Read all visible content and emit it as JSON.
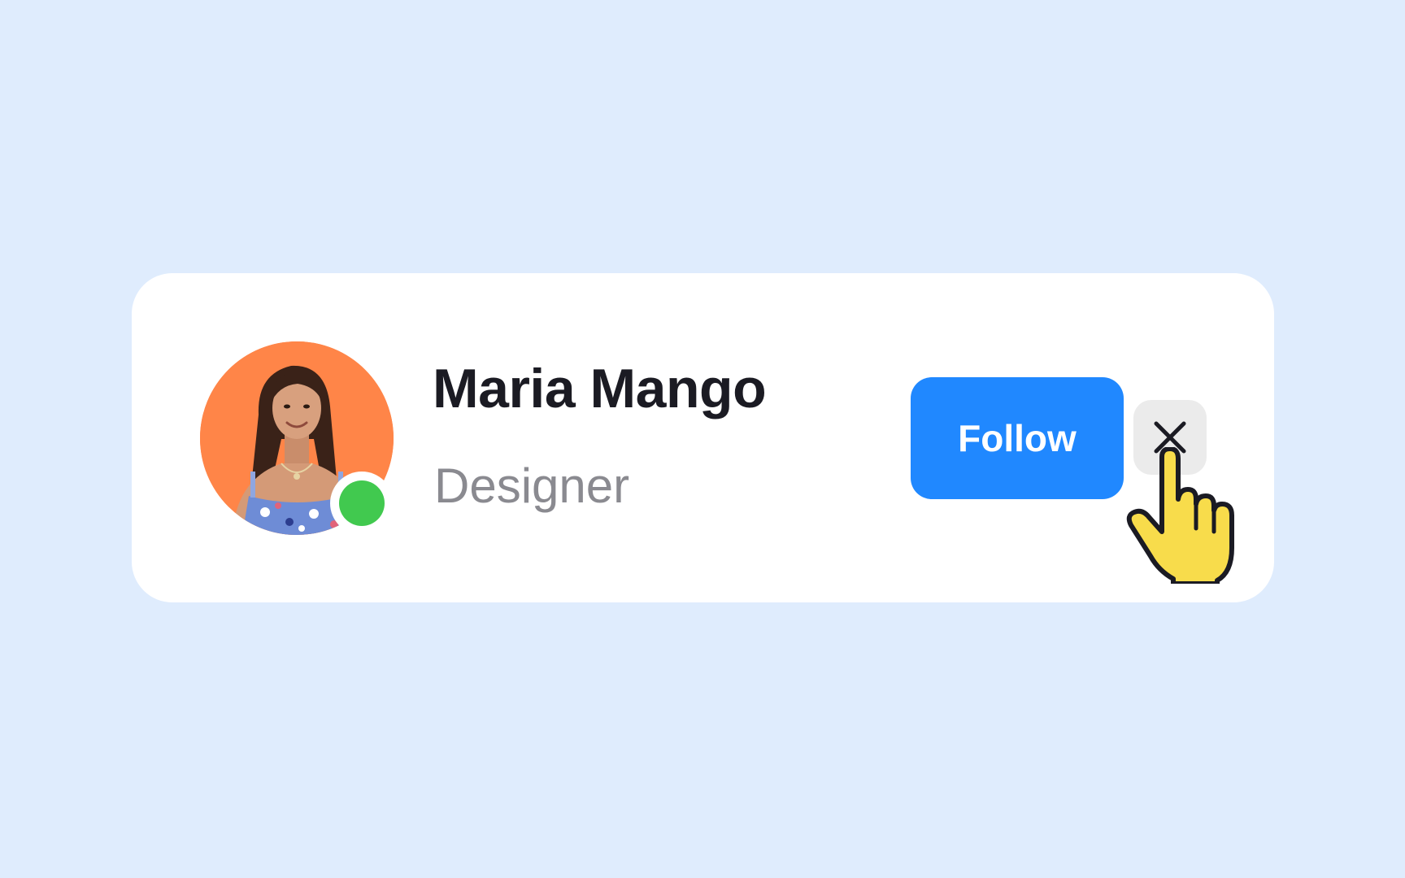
{
  "profile": {
    "name": "Maria Mango",
    "role": "Designer",
    "status": "online",
    "avatar_icon": "user-photo"
  },
  "actions": {
    "follow_label": "Follow",
    "close_icon": "close-icon",
    "cursor_icon": "hand-pointer-icon"
  },
  "colors": {
    "background": "#DFECFD",
    "card": "#FFFFFF",
    "avatar_bg": "#FF8548",
    "status_online": "#41C94F",
    "follow_button": "#2088FF",
    "close_button_bg": "#EBEBEB",
    "name_text": "#1B1B23",
    "role_text": "#8A8A90",
    "cursor_fill": "#F8DC4B"
  }
}
